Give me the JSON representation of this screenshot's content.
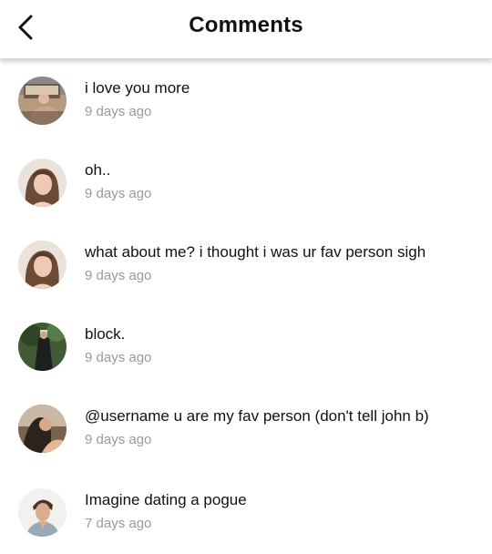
{
  "header": {
    "title": "Comments",
    "back_icon": "chevron-left-icon"
  },
  "comments": [
    {
      "text": "i love you more",
      "time": "9 days ago"
    },
    {
      "text": "oh..",
      "time": "9 days ago"
    },
    {
      "text": "what about me? i thought i was ur fav person sigh",
      "time": "9 days ago"
    },
    {
      "text": "block.",
      "time": "9 days ago"
    },
    {
      "text": "@username u are my fav person (don't tell john b)",
      "time": "9 days ago"
    },
    {
      "text": "Imagine dating a pogue",
      "time": "7 days ago"
    }
  ]
}
